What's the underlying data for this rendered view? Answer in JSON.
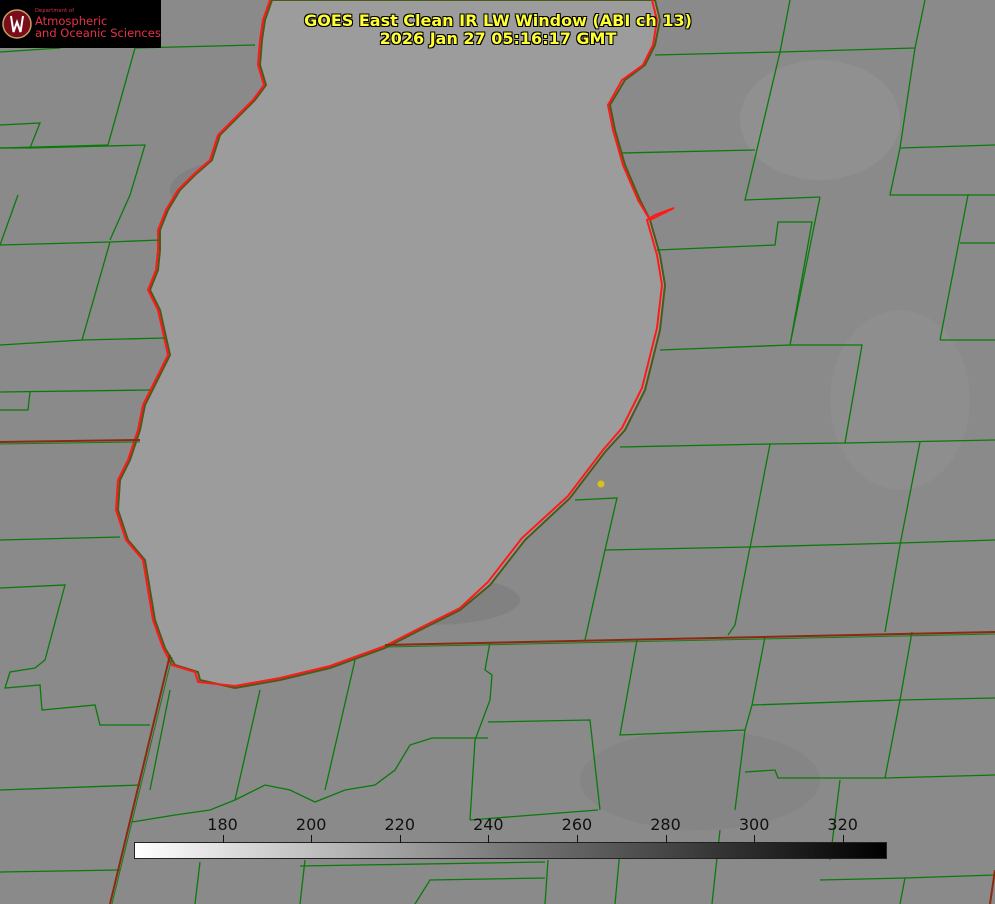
{
  "logo": {
    "department": "Department of",
    "line1": "Atmospheric",
    "line2": "and Oceanic Sciences",
    "color": "#e8324a",
    "icon": "uw-crest-icon"
  },
  "title": {
    "line1": "GOES East Clean IR LW Window (ABI ch 13)",
    "line2": "2026 Jan 27 05:16:17 GMT",
    "color": "#ffff33"
  },
  "colorbar": {
    "min": 160,
    "max": 330,
    "ticks": [
      180,
      200,
      220,
      240,
      260,
      280,
      300,
      320
    ],
    "colors": [
      "#ffffff",
      "#000000"
    ]
  },
  "map": {
    "background": "#8a8a8a",
    "lake_fill": "#9c9c9c",
    "county_color": "#0a7a0a",
    "state_color": "#8b2a10",
    "coast_color": "#ff1a1a",
    "marker_color": "#d6c21a"
  }
}
